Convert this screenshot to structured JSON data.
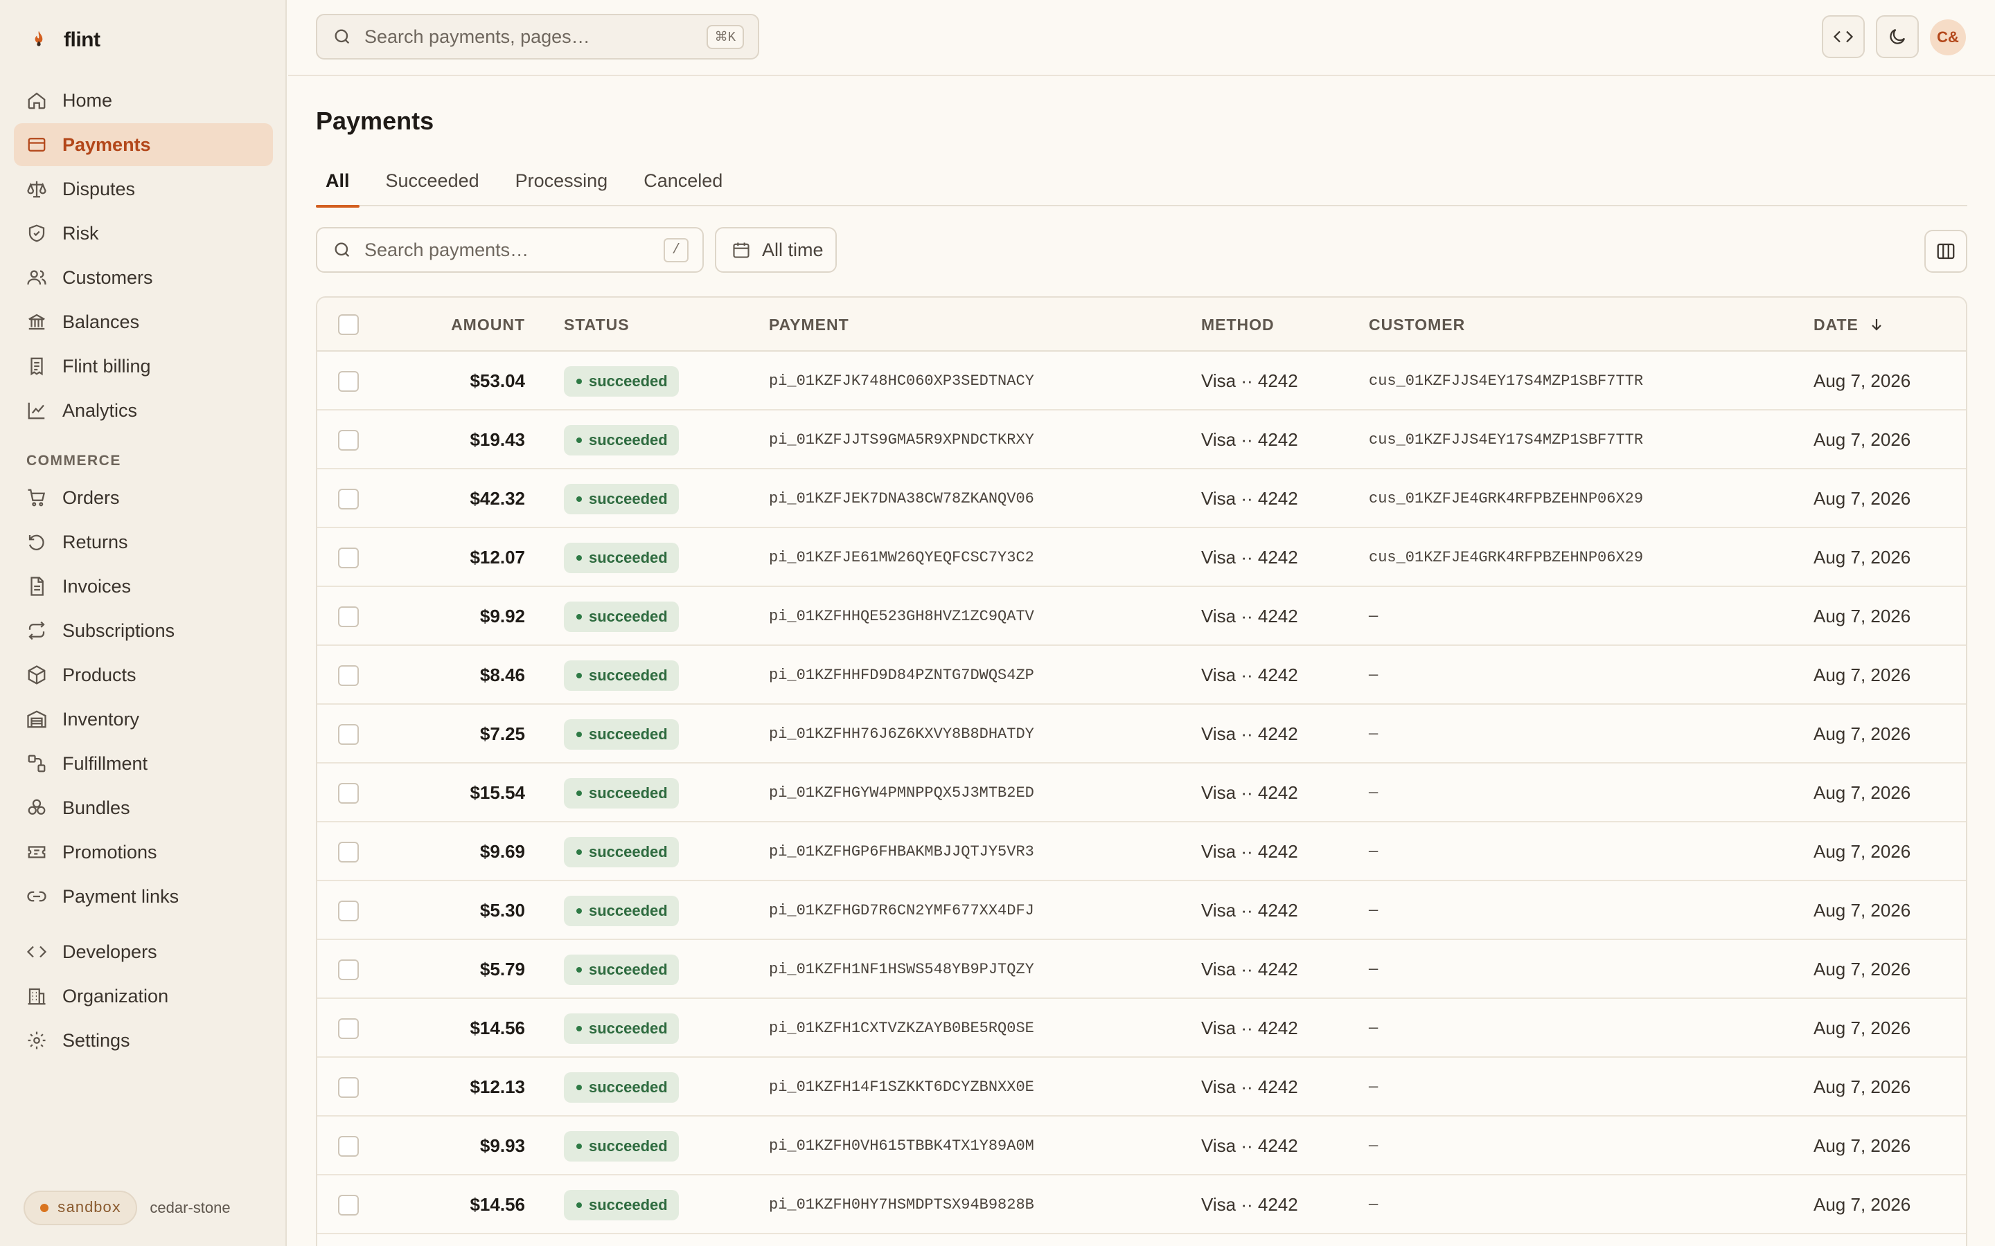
{
  "brand": {
    "name": "flint",
    "accent": "#d35f1f"
  },
  "sidebar": {
    "items": [
      {
        "label": "Home",
        "icon": "home-icon",
        "active": false
      },
      {
        "label": "Payments",
        "icon": "card-icon",
        "active": true
      },
      {
        "label": "Disputes",
        "icon": "scale-icon",
        "active": false
      },
      {
        "label": "Risk",
        "icon": "shield-icon",
        "active": false
      },
      {
        "label": "Customers",
        "icon": "users-icon",
        "active": false
      },
      {
        "label": "Balances",
        "icon": "bank-icon",
        "active": false
      },
      {
        "label": "Flint billing",
        "icon": "receipt-icon",
        "active": false
      },
      {
        "label": "Analytics",
        "icon": "chart-icon",
        "active": false
      }
    ],
    "commerce_heading": "COMMERCE",
    "commerce_items": [
      {
        "label": "Orders",
        "icon": "cart-icon"
      },
      {
        "label": "Returns",
        "icon": "return-icon"
      },
      {
        "label": "Invoices",
        "icon": "invoice-icon"
      },
      {
        "label": "Subscriptions",
        "icon": "repeat-icon"
      },
      {
        "label": "Products",
        "icon": "box-icon"
      },
      {
        "label": "Inventory",
        "icon": "warehouse-icon"
      },
      {
        "label": "Fulfillment",
        "icon": "fulfillment-icon"
      },
      {
        "label": "Bundles",
        "icon": "bundle-icon"
      },
      {
        "label": "Promotions",
        "icon": "ticket-icon"
      },
      {
        "label": "Payment links",
        "icon": "link-icon"
      }
    ],
    "bottom_items": [
      {
        "label": "Developers",
        "icon": "code-icon"
      },
      {
        "label": "Organization",
        "icon": "building-icon"
      },
      {
        "label": "Settings",
        "icon": "gear-icon"
      }
    ],
    "env": {
      "badge": "sandbox",
      "name": "cedar-stone"
    }
  },
  "topbar": {
    "search_placeholder": "Search payments, pages…",
    "search_shortcut": "⌘K",
    "avatar_initials": "C&"
  },
  "main": {
    "title": "Payments",
    "tabs": [
      {
        "label": "All",
        "active": true
      },
      {
        "label": "Succeeded",
        "active": false
      },
      {
        "label": "Processing",
        "active": false
      },
      {
        "label": "Canceled",
        "active": false
      }
    ],
    "search_placeholder": "Search payments…",
    "search_shortcut": "/",
    "date_filter": "All time"
  },
  "table": {
    "headers": {
      "amount": "AMOUNT",
      "status": "STATUS",
      "payment": "PAYMENT",
      "method": "METHOD",
      "customer": "CUSTOMER",
      "date": "DATE"
    },
    "rows": [
      {
        "amount": "$53.04",
        "status": "succeeded",
        "payment": "pi_01KZFJK748HC060XP3SEDTNACY",
        "method": "Visa ·· 4242",
        "customer": "cus_01KZFJJS4EY17S4MZP1SBF7TTR",
        "date": "Aug 7, 2026"
      },
      {
        "amount": "$19.43",
        "status": "succeeded",
        "payment": "pi_01KZFJJTS9GMA5R9XPNDCTKRXY",
        "method": "Visa ·· 4242",
        "customer": "cus_01KZFJJS4EY17S4MZP1SBF7TTR",
        "date": "Aug 7, 2026"
      },
      {
        "amount": "$42.32",
        "status": "succeeded",
        "payment": "pi_01KZFJEK7DNA38CW78ZKANQV06",
        "method": "Visa ·· 4242",
        "customer": "cus_01KZFJE4GRK4RFPBZEHNP06X29",
        "date": "Aug 7, 2026"
      },
      {
        "amount": "$12.07",
        "status": "succeeded",
        "payment": "pi_01KZFJE61MW26QYEQFCSC7Y3C2",
        "method": "Visa ·· 4242",
        "customer": "cus_01KZFJE4GRK4RFPBZEHNP06X29",
        "date": "Aug 7, 2026"
      },
      {
        "amount": "$9.92",
        "status": "succeeded",
        "payment": "pi_01KZFHHQE523GH8HVZ1ZC9QATV",
        "method": "Visa ·· 4242",
        "customer": "—",
        "date": "Aug 7, 2026"
      },
      {
        "amount": "$8.46",
        "status": "succeeded",
        "payment": "pi_01KZFHHFD9D84PZNTG7DWQS4ZP",
        "method": "Visa ·· 4242",
        "customer": "—",
        "date": "Aug 7, 2026"
      },
      {
        "amount": "$7.25",
        "status": "succeeded",
        "payment": "pi_01KZFHH76J6Z6KXVY8B8DHATDY",
        "method": "Visa ·· 4242",
        "customer": "—",
        "date": "Aug 7, 2026"
      },
      {
        "amount": "$15.54",
        "status": "succeeded",
        "payment": "pi_01KZFHGYW4PMNPPQX5J3MTB2ED",
        "method": "Visa ·· 4242",
        "customer": "—",
        "date": "Aug 7, 2026"
      },
      {
        "amount": "$9.69",
        "status": "succeeded",
        "payment": "pi_01KZFHGP6FHBAKMBJJQTJY5VR3",
        "method": "Visa ·· 4242",
        "customer": "—",
        "date": "Aug 7, 2026"
      },
      {
        "amount": "$5.30",
        "status": "succeeded",
        "payment": "pi_01KZFHGD7R6CN2YMF677XX4DFJ",
        "method": "Visa ·· 4242",
        "customer": "—",
        "date": "Aug 7, 2026"
      },
      {
        "amount": "$5.79",
        "status": "succeeded",
        "payment": "pi_01KZFH1NF1HSWS548YB9PJTQZY",
        "method": "Visa ·· 4242",
        "customer": "—",
        "date": "Aug 7, 2026"
      },
      {
        "amount": "$14.56",
        "status": "succeeded",
        "payment": "pi_01KZFH1CXTVZKZAYB0BE5RQ0SE",
        "method": "Visa ·· 4242",
        "customer": "—",
        "date": "Aug 7, 2026"
      },
      {
        "amount": "$12.13",
        "status": "succeeded",
        "payment": "pi_01KZFH14F1SZKKT6DCYZBNXX0E",
        "method": "Visa ·· 4242",
        "customer": "—",
        "date": "Aug 7, 2026"
      },
      {
        "amount": "$9.93",
        "status": "succeeded",
        "payment": "pi_01KZFH0VH615TBBK4TX1Y89A0M",
        "method": "Visa ·· 4242",
        "customer": "—",
        "date": "Aug 7, 2026"
      },
      {
        "amount": "$14.56",
        "status": "succeeded",
        "payment": "pi_01KZFH0HY7HSMDPTSX94B9828B",
        "method": "Visa ·· 4242",
        "customer": "—",
        "date": "Aug 7, 2026"
      }
    ]
  }
}
